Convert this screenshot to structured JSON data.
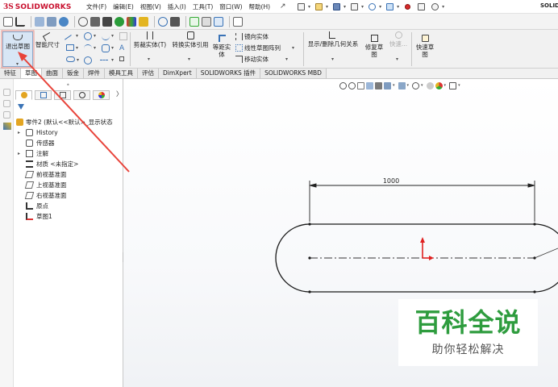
{
  "titlebar": {
    "logo_ds": "3S",
    "logo_text": "SOLIDWORKS",
    "menu": [
      "文件(F)",
      "编辑(E)",
      "视图(V)",
      "插入(I)",
      "工具(T)",
      "窗口(W)",
      "帮助(H)"
    ],
    "window_title_fragment": "SOLID"
  },
  "command_manager": {
    "exit_sketch": "退出草图",
    "smart_dimension": "智能尺寸",
    "trim_entities": "剪裁实体(T)",
    "convert_entities": "转换实体引用",
    "offset_entities": "等距实\n体",
    "mirror_entities": "镜向实体",
    "linear_pattern": "线性草图阵列",
    "move_entities": "移动实体",
    "display_delete_relations": "显示/删除几何关系",
    "repair_sketch": "修复草\n图",
    "quick_snaps_disabled": "快速...",
    "rapid_sketch": "快速草\n图"
  },
  "tabs": [
    {
      "label": "特征",
      "active": false
    },
    {
      "label": "草图",
      "active": true
    },
    {
      "label": "曲面",
      "active": false
    },
    {
      "label": "钣金",
      "active": false
    },
    {
      "label": "焊件",
      "active": false
    },
    {
      "label": "模具工具",
      "active": false
    },
    {
      "label": "评估",
      "active": false
    },
    {
      "label": "DimXpert",
      "active": false
    },
    {
      "label": "SOLIDWORKS 插件",
      "active": false
    },
    {
      "label": "SOLIDWORKS MBD",
      "active": false
    }
  ],
  "feature_tree": {
    "more": "〉",
    "items": [
      {
        "label": "零件2 (默认<<默认>_显示状态",
        "icon": "part-icon"
      },
      {
        "label": "History",
        "icon": "history-icon"
      },
      {
        "label": "传感器",
        "icon": "sensor-icon"
      },
      {
        "label": "注解",
        "icon": "annotation-icon"
      },
      {
        "label": "材质 <未指定>",
        "icon": "material-icon"
      },
      {
        "label": "前视基准面",
        "icon": "plane-icon"
      },
      {
        "label": "上视基准面",
        "icon": "plane-icon"
      },
      {
        "label": "右视基准面",
        "icon": "plane-icon"
      },
      {
        "label": "原点",
        "icon": "origin-icon"
      },
      {
        "label": "草图1",
        "icon": "sketch-icon"
      }
    ]
  },
  "sketch": {
    "dimension_value": "1000"
  },
  "watermark": {
    "main": "百科全说",
    "sub": "助你轻松解决"
  },
  "colors": {
    "brand_red": "#c8102e",
    "annotation_arrow": "#e8433a",
    "origin_red": "#e02020",
    "watermark_green": "#2e9c3e"
  }
}
